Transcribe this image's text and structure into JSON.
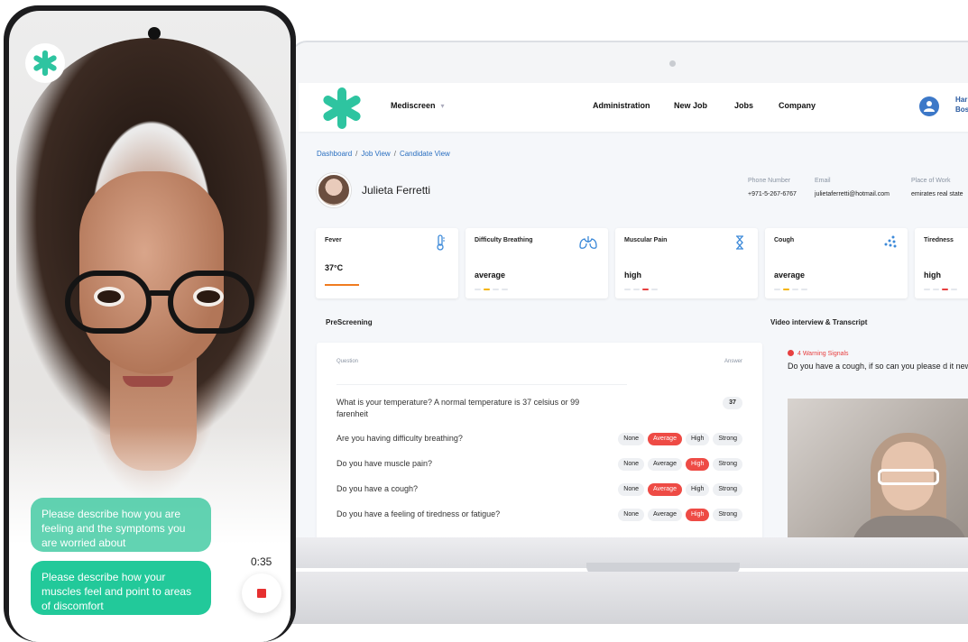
{
  "nav": {
    "brand": "Mediscreen",
    "links": [
      "Administration",
      "New Job",
      "Jobs",
      "Company"
    ],
    "user_line1": "Har",
    "user_line2": "Bos"
  },
  "breadcrumb": [
    "Dashboard",
    "Job View",
    "Candidate View"
  ],
  "candidate": {
    "name": "Julieta Ferretti",
    "info": [
      {
        "label": "Phone Number",
        "value": "+971-5-267-6767"
      },
      {
        "label": "Email",
        "value": "julietaferretti@hotmail.com"
      },
      {
        "label": "Place of Work",
        "value": "emirates real state"
      }
    ]
  },
  "symptoms": [
    {
      "title": "Fever",
      "value": "37°C",
      "icon": "thermometer-icon"
    },
    {
      "title": "Difficulty Breathing",
      "value": "average",
      "icon": "lungs-icon",
      "level": 2
    },
    {
      "title": "Muscular Pain",
      "value": "high",
      "icon": "muscle-icon",
      "level": 3
    },
    {
      "title": "Cough",
      "value": "average",
      "icon": "virus-icon",
      "level": 2
    },
    {
      "title": "Tiredness",
      "value": "high",
      "icon": "tired-icon",
      "level": 3
    }
  ],
  "sections": {
    "prescreening": "PreScreening",
    "video": "Video interview & Transcript"
  },
  "prescreen": {
    "col_question": "Question",
    "col_answer": "Answer",
    "options": [
      "None",
      "Average",
      "High",
      "Strong"
    ],
    "questions": [
      {
        "text": "What is your temperature? A normal temperature is 37 celsius or 99 farenheit",
        "answer": "37"
      },
      {
        "text": "Are you having difficulty breathing?",
        "selected": "Average"
      },
      {
        "text": "Do you have muscle pain?",
        "selected": "High"
      },
      {
        "text": "Do you have a cough?",
        "selected": "Average"
      },
      {
        "text": "Do you have a feeling of tiredness or fatigue?",
        "selected": "High"
      }
    ]
  },
  "video": {
    "warning": "4 Warning Signals",
    "question": "Do you have a cough, if so can you please d it new?"
  },
  "phone": {
    "bubble1": "Please describe how you are feeling and the symptoms you are worried about",
    "bubble2": "Please describe how your muscles feel and point to areas of discomfort",
    "timer": "0:35"
  },
  "colors": {
    "brand": "#2ec4a0",
    "accent_blue": "#2a6fc0",
    "alert_red": "#ee4b45",
    "fever_orange": "#f07b20"
  }
}
